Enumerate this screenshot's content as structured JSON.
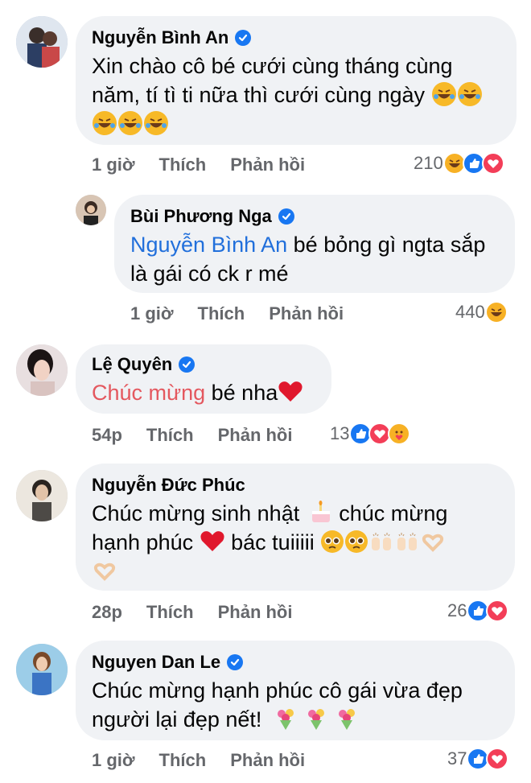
{
  "comments": [
    {
      "name": "Nguyễn Bình An",
      "text_lines": [
        "Xin chào cô bé cưới cùng tháng cùng",
        "năm, tí tì ti nữa thì cưới cùng ngày"
      ],
      "time": "1 giờ",
      "like": "Thích",
      "reply": "Phản hồi",
      "reaction_count": "210"
    },
    {
      "name": "Bùi Phương Nga",
      "mention": "Nguyễn Bình An",
      "text_rest": " bé bỏng gì ngta sắp",
      "text_line2": "là gái có ck r mé",
      "time": "1 giờ",
      "like": "Thích",
      "reply": "Phản hồi",
      "reaction_count": "440"
    },
    {
      "name": "Lệ Quyên",
      "highlight": "Chúc mừng",
      "text_rest": " bé nha",
      "time": "54p",
      "like": "Thích",
      "reply": "Phản hồi",
      "reaction_count": "13"
    },
    {
      "name": "Nguyễn Đức Phúc",
      "line1": "Chúc mừng sinh nhật",
      "line1b": " chúc mừng",
      "line2": "hạnh phúc",
      "line2b": " bác tuiiiii",
      "time": "28p",
      "like": "Thích",
      "reply": "Phản hồi",
      "reaction_count": "26"
    },
    {
      "name": "Nguyen Dan Le",
      "text_lines": [
        "Chúc mừng hạnh phúc cô gái vừa đẹp",
        "người lại đẹp nết!"
      ],
      "time": "1 giờ",
      "like": "Thích",
      "reply": "Phản hồi",
      "reaction_count": "37"
    }
  ],
  "colors": {
    "bubble": "#f0f2f5",
    "verified": "#1877f2",
    "mention": "#216fdb",
    "highlight": "#e4585f",
    "meta": "#65676b"
  },
  "icons": [
    "verified-badge-icon",
    "rofl-emoji-icon",
    "haha-reaction-icon",
    "like-reaction-icon",
    "love-reaction-icon",
    "care-reaction-icon",
    "red-heart-icon",
    "birthday-cake-icon",
    "pleading-face-icon",
    "raising-hands-icon",
    "heart-hands-icon",
    "bouquet-icon"
  ]
}
